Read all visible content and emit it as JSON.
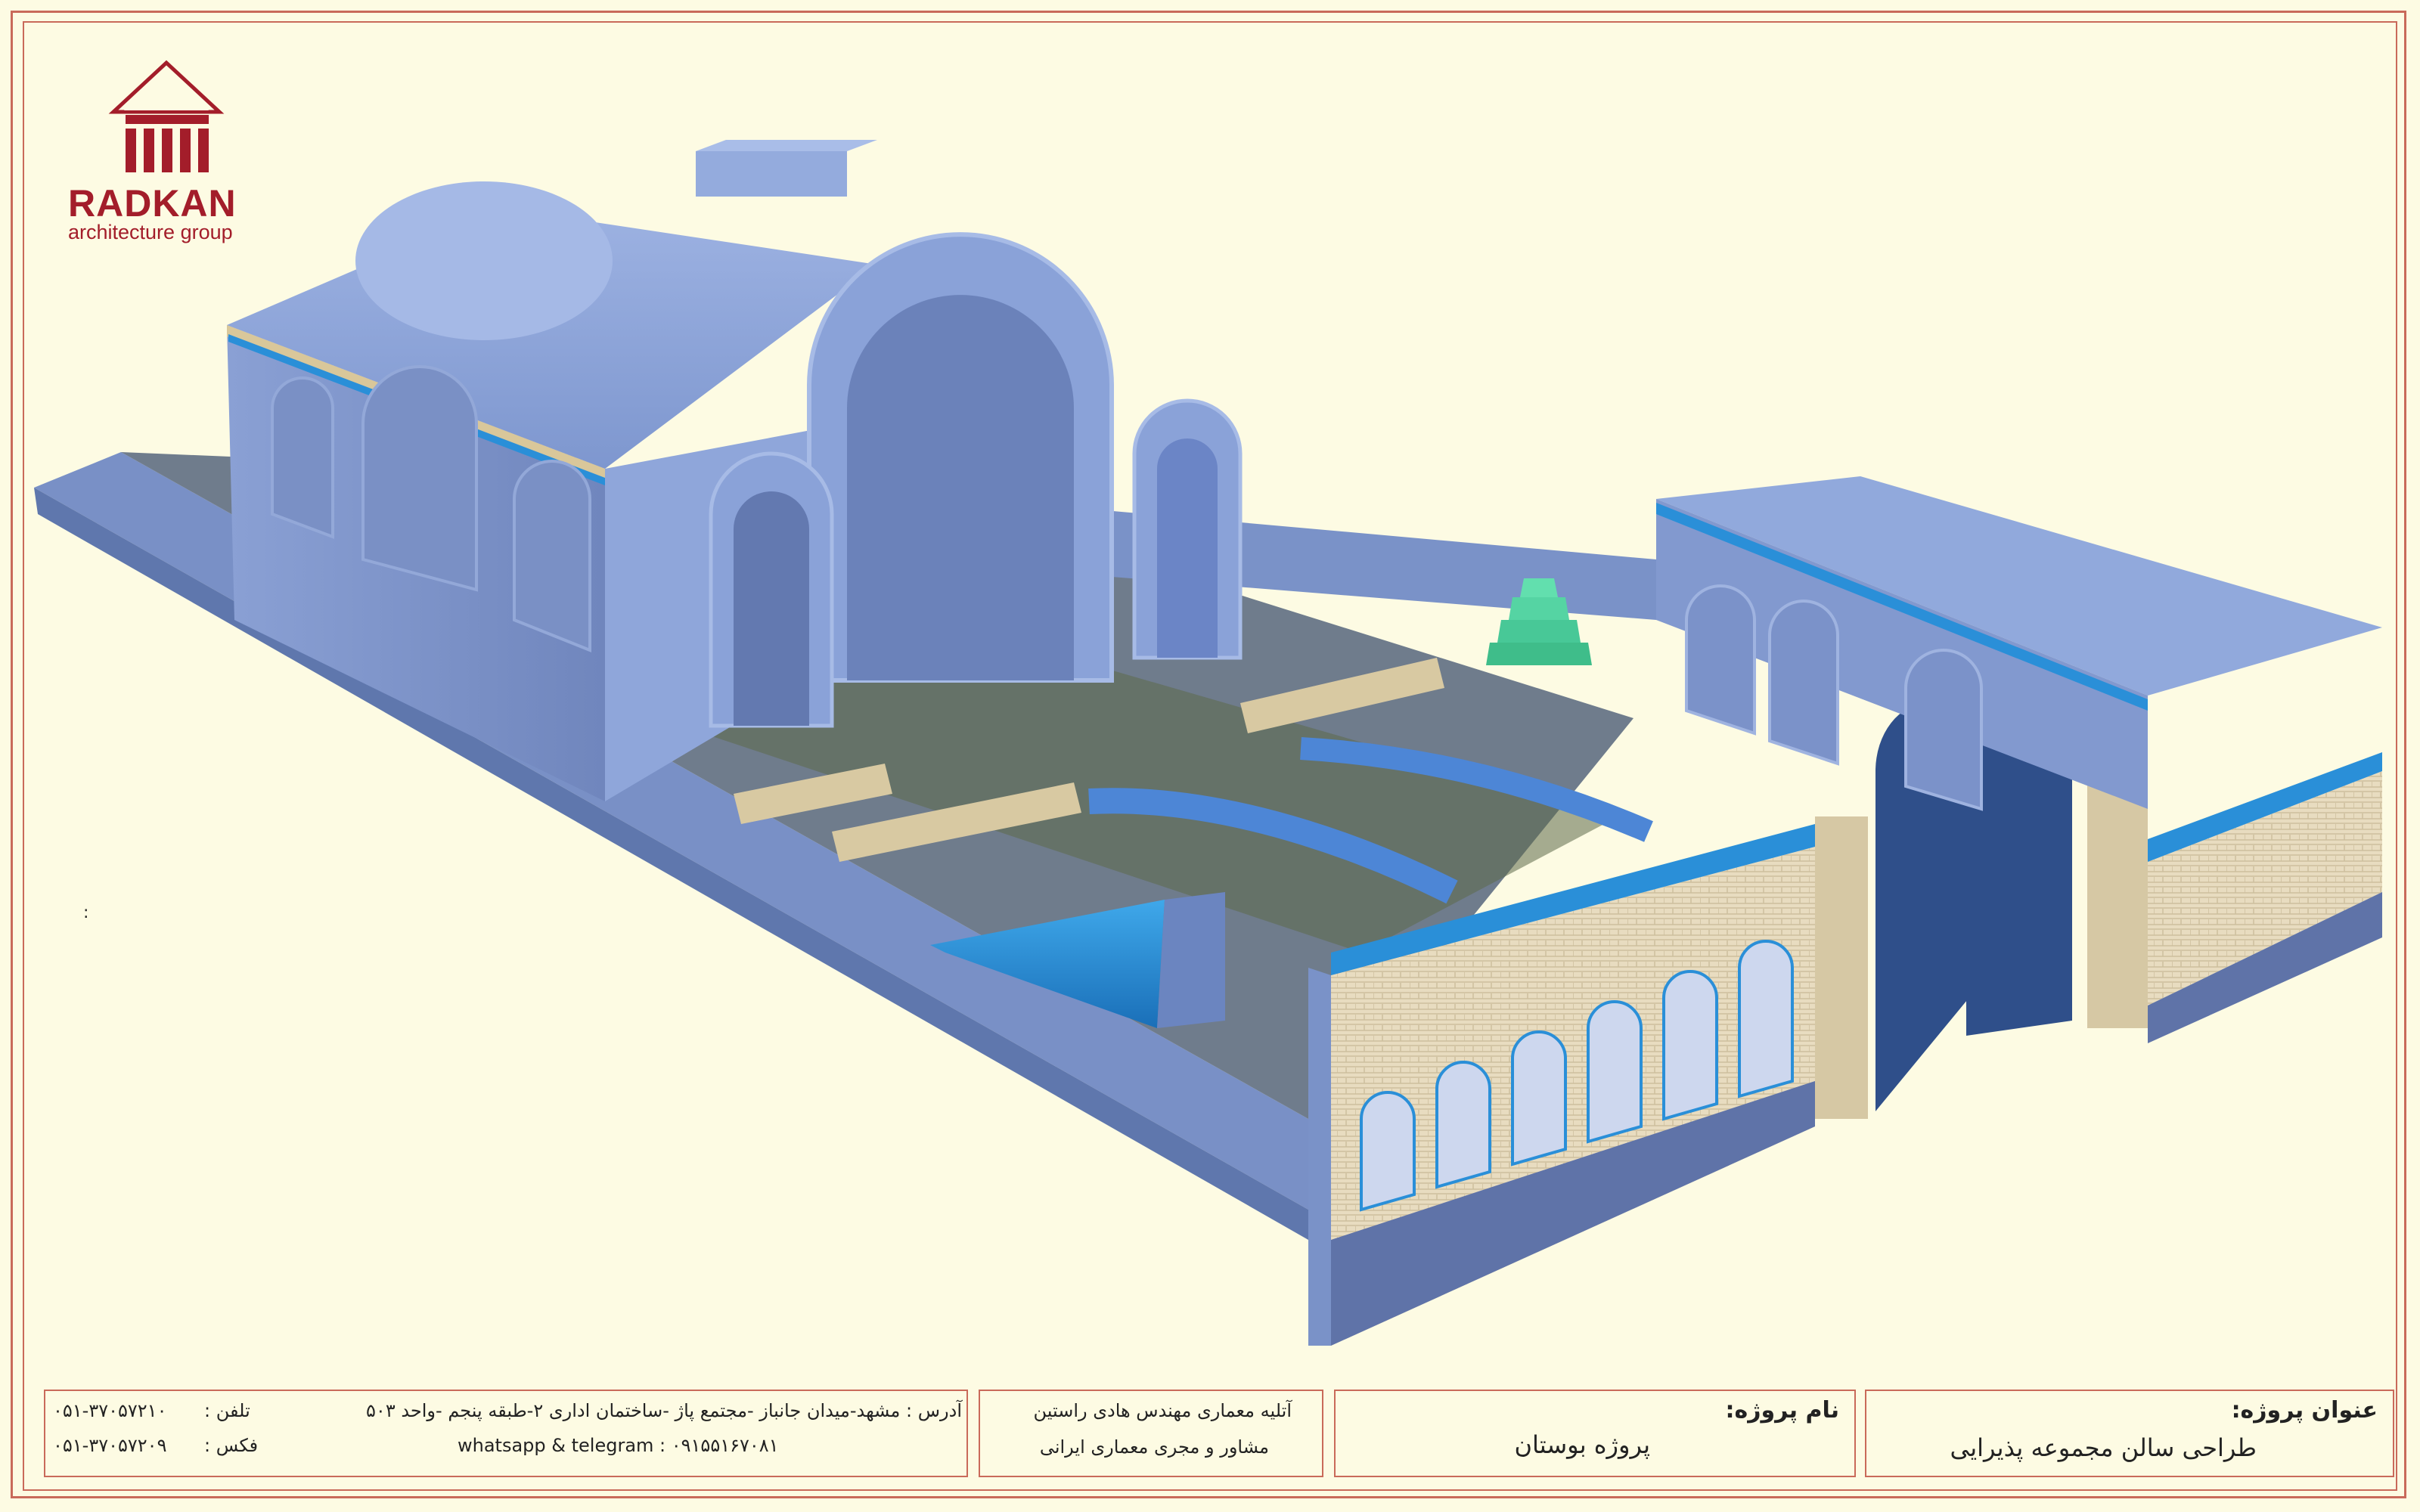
{
  "logo": {
    "name": "RADKAN",
    "subtitle": "architecture group",
    "icon": "temple-columns-icon",
    "color": "#a31d2a"
  },
  "stray_mark": ":",
  "title_block": {
    "project_title_label": "عنوان پروژه:",
    "project_title_value": "طراحی سالن مجموعه  پذیرایی",
    "project_name_label": "نام پروژه:",
    "project_name_value": "پروژه بوستان",
    "studio_line1": "آتلیه معماری مهندس هادی راستین",
    "studio_line2": "مشاور و مجری معماری ایرانی",
    "address": "آدرس : مشهد-میدان جانباز -مجتمع پاژ -ساختمان اداری ۲-طبقه پنجم -واحد ۵۰۳",
    "social": "whatsapp & telegram : ۰۹۱۵۵۱۶۷۰۸۱",
    "phone_label": "تلفن :",
    "phone_value": "۰۵۱-۳۷۰۵۷۲۱۰",
    "fax_label": "فکس :",
    "fax_value": "۰۵۱-۳۷۰۵۷۲۰۹"
  },
  "colors": {
    "background": "#fdfbe3",
    "frame": "#c96a5a",
    "building": "#7f98cc",
    "pool": "#2a8fd8",
    "stair": "#48c897"
  }
}
